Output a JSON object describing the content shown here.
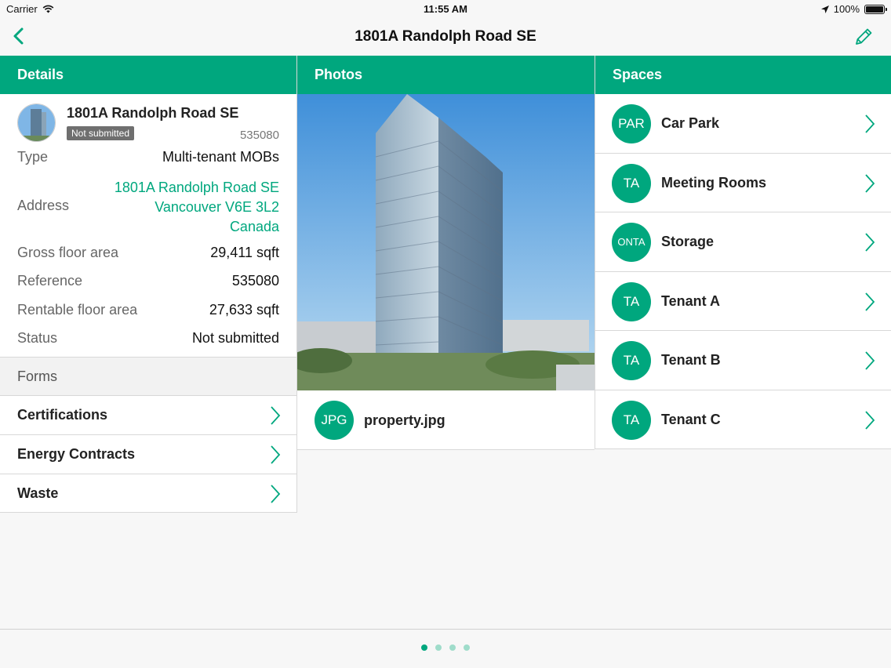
{
  "status_bar": {
    "carrier": "Carrier",
    "time": "11:55 AM",
    "battery": "100%"
  },
  "nav": {
    "title": "1801A Randolph Road SE",
    "back_icon": "chevron-left-icon",
    "edit_icon": "pencil-icon"
  },
  "colors": {
    "accent": "#00a77e",
    "badge": "#6f6f6f"
  },
  "details": {
    "header": "Details",
    "property_name": "1801A Randolph Road SE",
    "badge": "Not submitted",
    "reference_id": "535080",
    "fields": {
      "type_label": "Type",
      "type_value": "Multi-tenant MOBs",
      "address_label": "Address",
      "address_line1": "1801A Randolph Road SE",
      "address_line2": "Vancouver  V6E 3L2",
      "address_line3": "Canada",
      "gfa_label": "Gross floor area",
      "gfa_value": "29,411 sqft",
      "reference_label": "Reference",
      "reference_value": "535080",
      "rfa_label": "Rentable floor area",
      "rfa_value": "27,633 sqft",
      "status_label": "Status",
      "status_value": "Not submitted"
    },
    "forms_header": "Forms",
    "forms": [
      "Certifications",
      "Energy Contracts",
      "Waste"
    ]
  },
  "photos": {
    "header": "Photos",
    "file_badge": "JPG",
    "file_name": "property.jpg"
  },
  "spaces": {
    "header": "Spaces",
    "items": [
      {
        "badge": "PAR",
        "name": "Car Park"
      },
      {
        "badge": "TA",
        "name": "Meeting Rooms"
      },
      {
        "badge": "ONTA",
        "name": "Storage"
      },
      {
        "badge": "TA",
        "name": "Tenant A"
      },
      {
        "badge": "TA",
        "name": "Tenant B"
      },
      {
        "badge": "TA",
        "name": "Tenant C"
      }
    ]
  },
  "pager": {
    "pages": 4,
    "current": 1
  }
}
